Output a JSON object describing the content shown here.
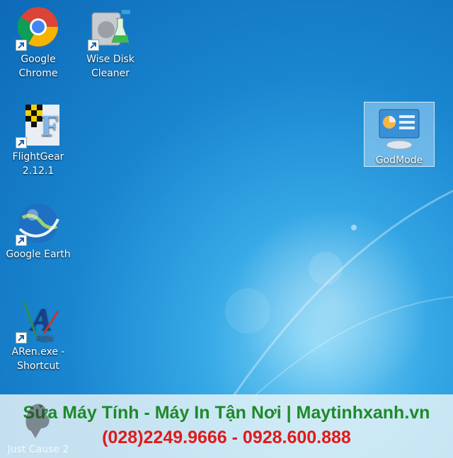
{
  "desktop": {
    "icons": [
      {
        "label1": "Google",
        "label2": "Chrome"
      },
      {
        "label1": "Wise Disk",
        "label2": "Cleaner"
      },
      {
        "label1": "FlightGear",
        "label2": "2.12.1"
      },
      {
        "label1": "Google Earth",
        "label2": ""
      },
      {
        "label1": "ARen.exe -",
        "label2": "Shortcut"
      },
      {
        "label1": "GodMode",
        "label2": ""
      },
      {
        "label1": "Just Cause 2",
        "label2": ""
      }
    ]
  },
  "banner": {
    "line1": "Sửa Máy Tính - Máy In Tận Nơi | Maytinhxanh.vn",
    "line2": "(028)2249.9666 - 0928.600.888"
  },
  "colors": {
    "banner_green": "#1e8a2a",
    "banner_red": "#e01a1a",
    "desktop_blue": "#1a86d0"
  }
}
